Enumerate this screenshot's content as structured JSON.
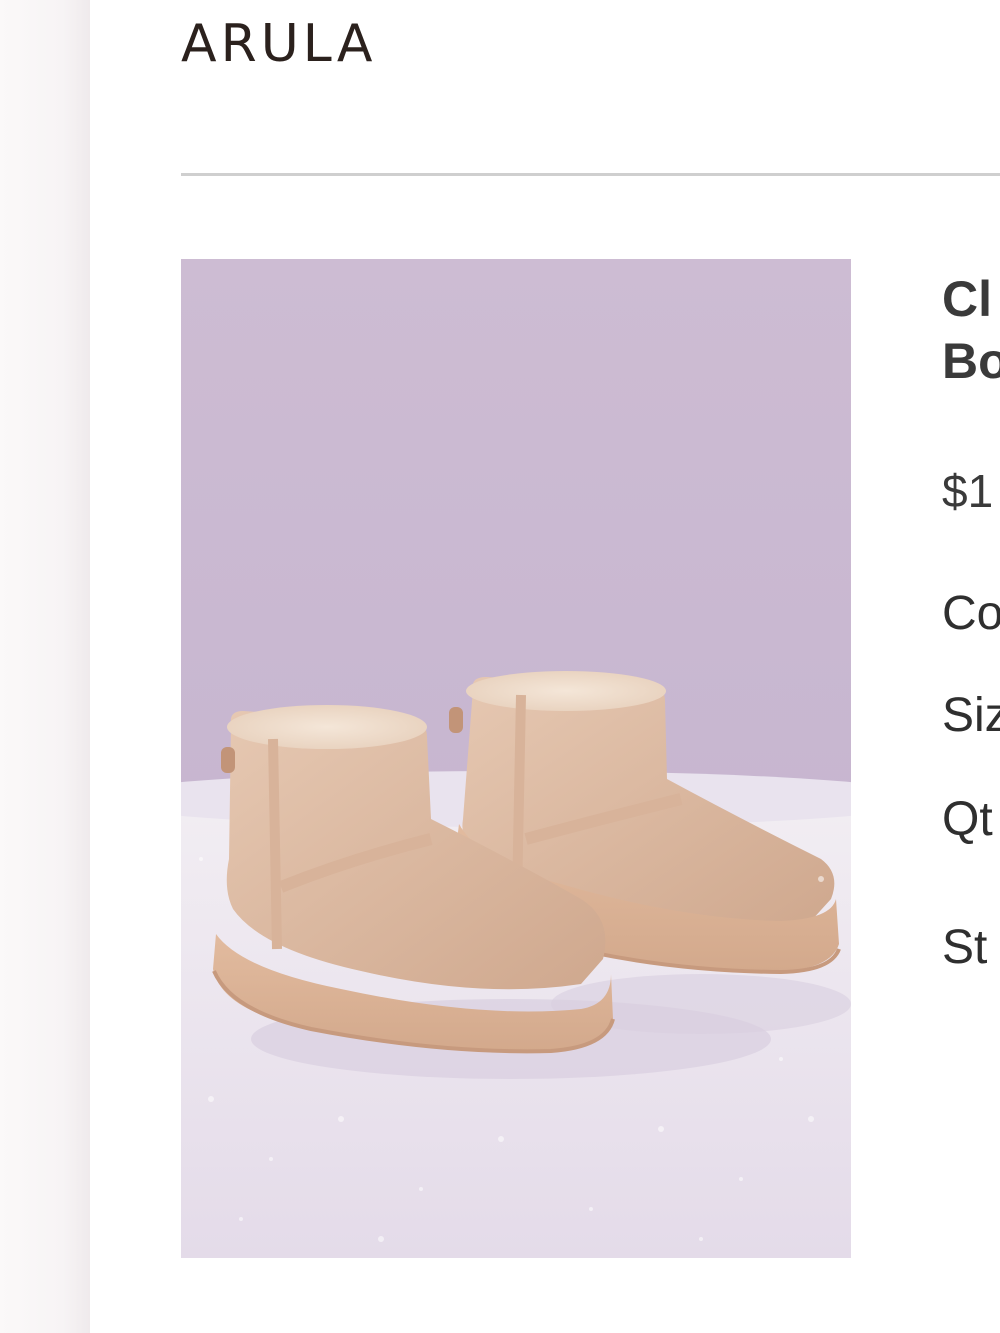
{
  "header": {
    "brand": "ARULA"
  },
  "product": {
    "image_alt": "Beige shearling mini boots with platform soles on white snow against a lavender backdrop",
    "title_line1": "Cl",
    "title_line2": "Bo",
    "price": "$1",
    "options": {
      "color_label": "Co",
      "size_label": "Siz",
      "qty_label": "Qt",
      "stock_label": "St"
    }
  },
  "colors": {
    "background": "#ffffff",
    "brand_text": "#2b211d",
    "divider": "#cfcfcf",
    "image_backdrop": "#d3c2d6",
    "boot": "#dcb9a0"
  }
}
